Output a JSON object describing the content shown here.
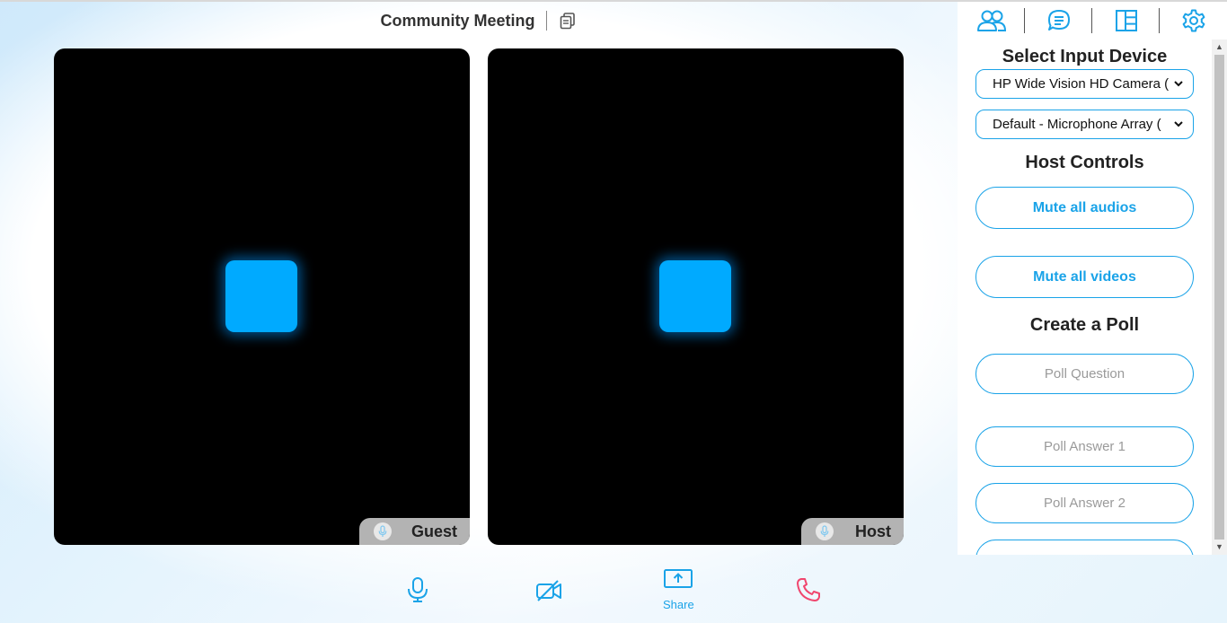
{
  "header": {
    "title": "Community Meeting"
  },
  "tiles": [
    {
      "name": "Guest"
    },
    {
      "name": "Host"
    }
  ],
  "controls": {
    "share_label": "Share"
  },
  "sidebar": {
    "tabs": [
      "participants",
      "chat",
      "layout",
      "settings"
    ],
    "input_device_title": "Select Input Device",
    "camera_selected": "HP Wide Vision HD Camera (",
    "mic_selected": "Default - Microphone Array (",
    "host_controls_title": "Host Controls",
    "mute_audios_label": "Mute all audios",
    "mute_videos_label": "Mute all videos",
    "poll_title": "Create a Poll",
    "poll_question_placeholder": "Poll Question",
    "poll_answer1_placeholder": "Poll Answer 1",
    "poll_answer2_placeholder": "Poll Answer 2"
  },
  "colors": {
    "accent": "#1aa3e8",
    "avatar": "#00aaff",
    "end_call": "#f0466e"
  }
}
